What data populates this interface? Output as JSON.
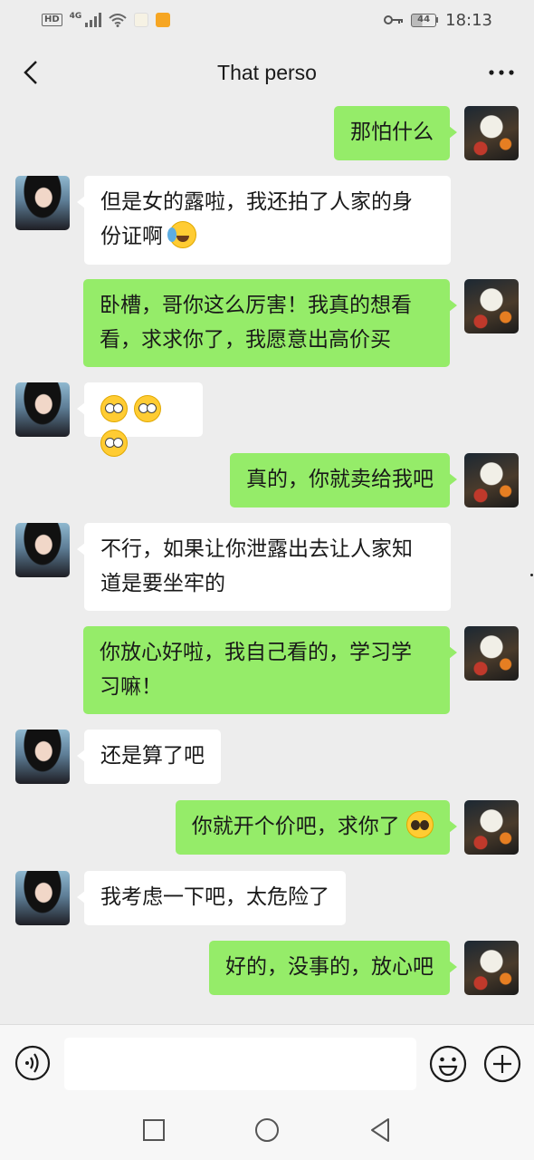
{
  "status_bar": {
    "hd": "HD",
    "network": "4G",
    "battery": "44",
    "time": "18:13"
  },
  "header": {
    "title": "That perso"
  },
  "messages": [
    {
      "sender": "self",
      "text": "那怕什么"
    },
    {
      "sender": "other",
      "line1": "但是女的露啦，我还拍了人家的身",
      "line2": "份证啊",
      "emoji": "face-with-tears-emoji"
    },
    {
      "sender": "self",
      "line1": "卧槽，哥你这么厉害！我真的想看",
      "line2": "看，求求你了，我愿意出高价买"
    },
    {
      "sender": "other",
      "emojis": [
        "flushed-face-emoji",
        "flushed-face-emoji",
        "flushed-face-emoji"
      ]
    },
    {
      "sender": "self",
      "text": "真的，你就卖给我吧"
    },
    {
      "sender": "other",
      "line1": "不行，如果让你泄露出去让人家知",
      "line2": "道是要坐牢的"
    },
    {
      "sender": "self",
      "line1": "你放心好啦，我自己看的，学习学",
      "line2": "习嘛！"
    },
    {
      "sender": "other",
      "text": "还是算了吧"
    },
    {
      "sender": "self",
      "text": "你就开个价吧，求你了",
      "emoji": "pleading-face-emoji"
    },
    {
      "sender": "other",
      "text": "我考虑一下吧，太危险了"
    },
    {
      "sender": "self",
      "text": "好的，没事的，放心吧"
    }
  ],
  "input": {
    "value": ""
  },
  "colors": {
    "self_bubble": "#95ec69",
    "other_bubble": "#ffffff",
    "background": "#ededed"
  }
}
